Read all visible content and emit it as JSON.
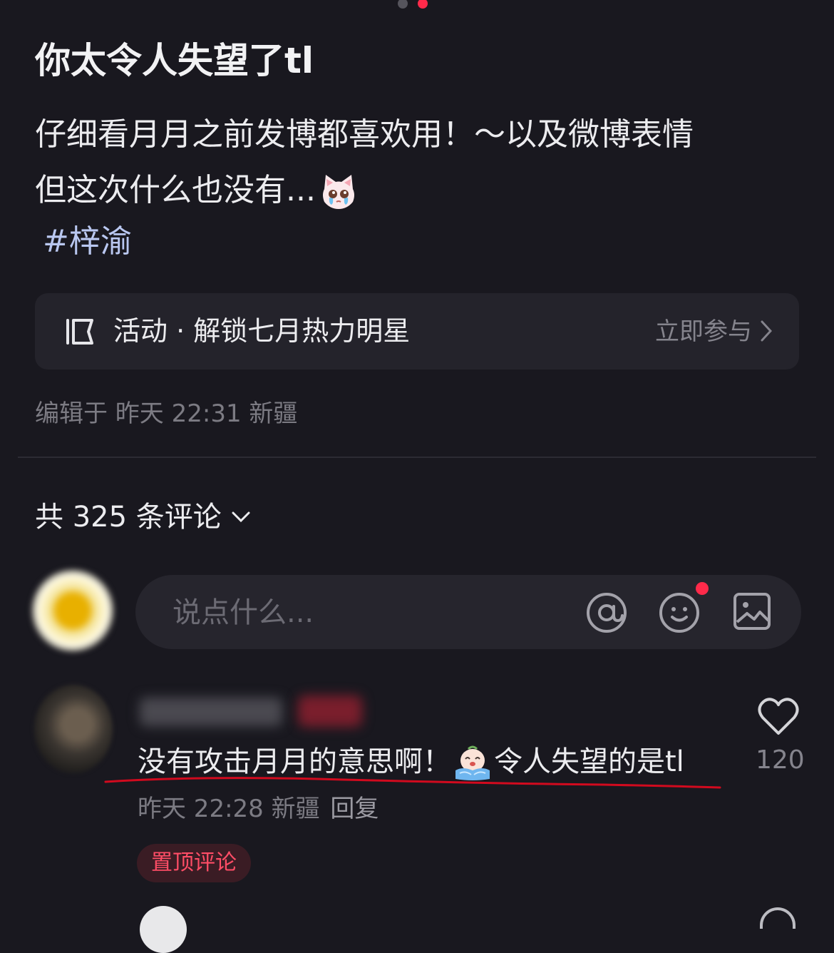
{
  "post": {
    "title": "你太令人失望了tl",
    "body_line1": "仔细看月月之前发博都喜欢用！～以及微博表情",
    "body_line2": "但这次什么也没有...",
    "hashtag": "#梓渝",
    "emoji": "crying-cat-emoji"
  },
  "activity": {
    "label": "活动 · 解锁七月热力明星",
    "cta": "立即参与",
    "icon": "activity-icon"
  },
  "meta": {
    "edited": "编辑于 昨天 22:31 新疆"
  },
  "comments": {
    "count_label": "共 325 条评论",
    "input_placeholder": "说点什么...",
    "items": [
      {
        "text": "没有攻击月月的意思啊！",
        "text_after": "令人失望的是tl",
        "meta": "昨天 22:28 新疆",
        "reply": "回复",
        "likes": "120",
        "pin_label": "置顶评论"
      }
    ]
  },
  "colors": {
    "background": "#19181f",
    "accent_red": "#ff2a4a",
    "hashtag": "#b9c7f0",
    "underline_annotation": "#d10a1e"
  }
}
